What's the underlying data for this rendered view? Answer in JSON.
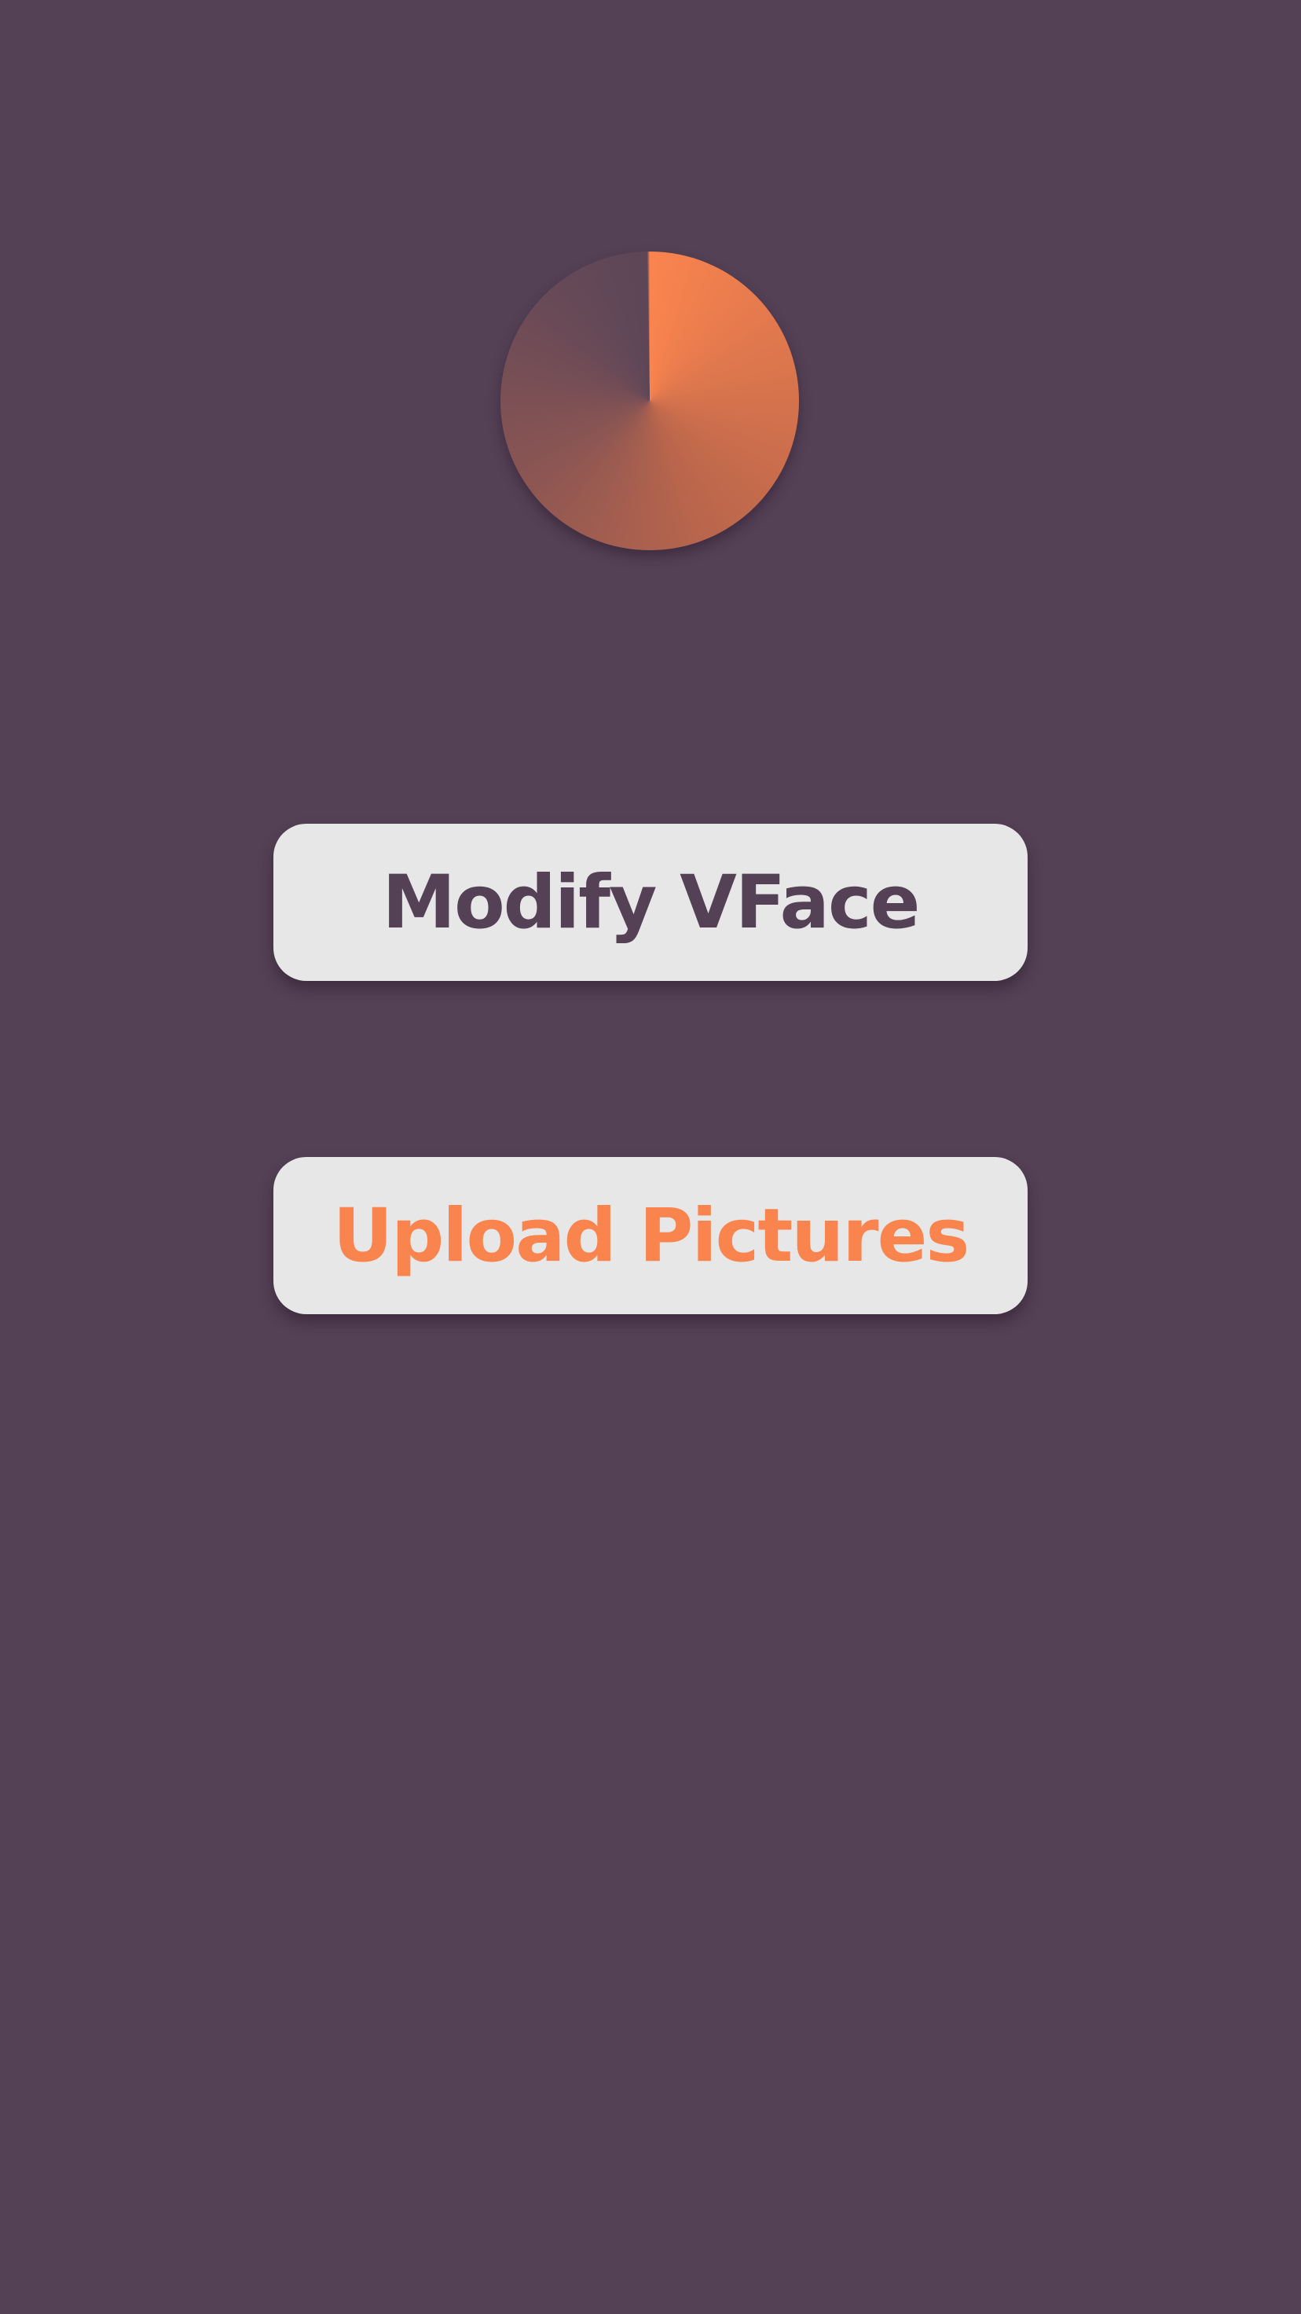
{
  "colors": {
    "background": "#544155",
    "button_surface": "#e8e7e8",
    "accent_orange": "#fa844e",
    "text_purple": "#544155"
  },
  "loader": {
    "icon": "loading-spinner-icon"
  },
  "buttons": {
    "modify_label": "Modify VFace",
    "upload_label": "Upload Pictures"
  }
}
